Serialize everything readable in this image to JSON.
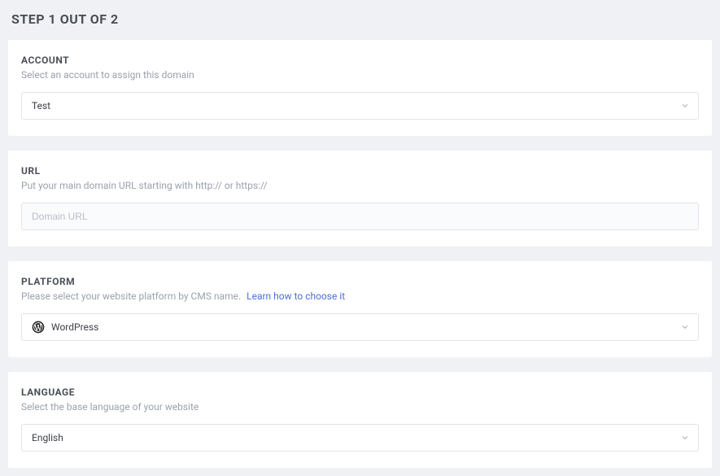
{
  "step": {
    "title": "STEP 1 OUT OF 2"
  },
  "account": {
    "heading": "ACCOUNT",
    "sub": "Select an account to assign this domain",
    "selected": "Test"
  },
  "url": {
    "heading": "URL",
    "sub": "Put your main domain URL starting with http:// or https://",
    "placeholder": "Domain URL",
    "value": ""
  },
  "platform": {
    "heading": "PLATFORM",
    "sub": "Please select your website platform by CMS name.",
    "link": "Learn how to choose it",
    "selected": "WordPress"
  },
  "language": {
    "heading": "LANGUAGE",
    "sub": "Select the base language of your website",
    "selected": "English"
  }
}
